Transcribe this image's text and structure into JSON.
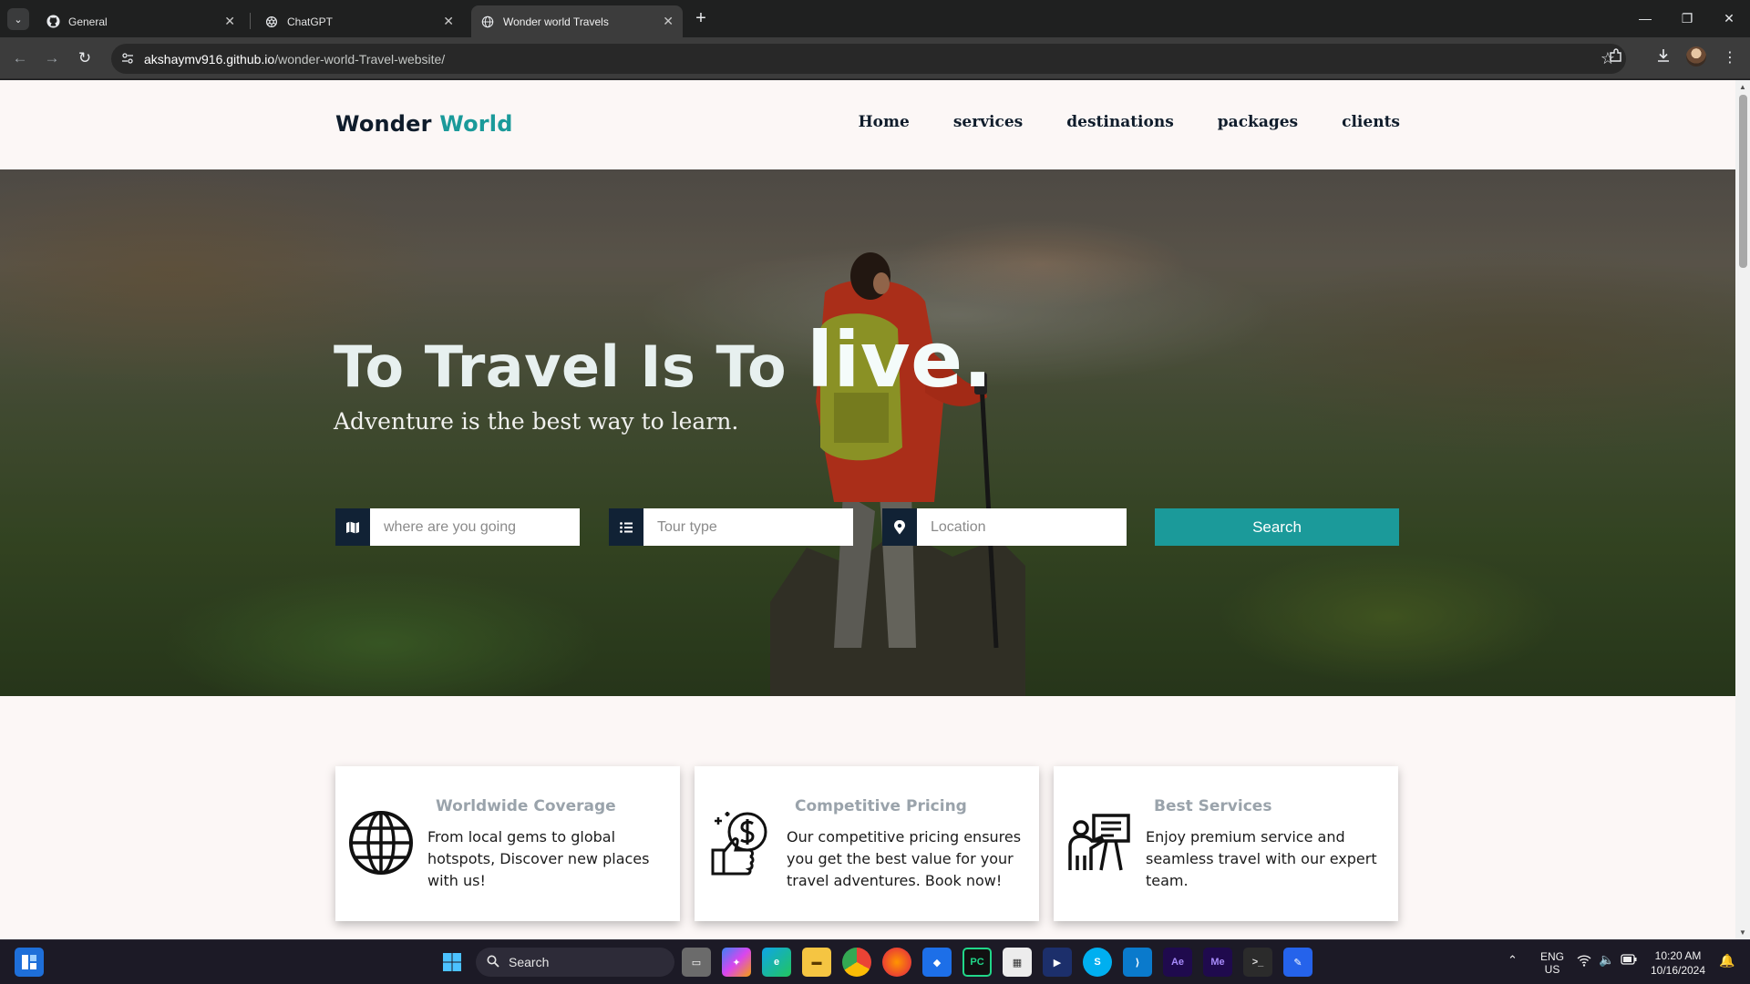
{
  "browser": {
    "tabs": [
      {
        "title": "General",
        "icon": "github-icon"
      },
      {
        "title": "ChatGPT",
        "icon": "chatgpt-icon"
      },
      {
        "title": "Wonder world Travels",
        "icon": "globe-icon",
        "active": true
      }
    ],
    "url_host": "akshaymv916.github.io",
    "url_path": "/wonder-world-Travel-website/"
  },
  "site": {
    "logo_main": "Wonder",
    "logo_accent": "World",
    "nav": [
      "Home",
      "services",
      "destinations",
      "packages",
      "clients"
    ],
    "hero": {
      "title_prefix": "To Travel Is To",
      "title_emphasis": "live.",
      "subtitle": "Adventure is the best way to learn."
    },
    "search": {
      "destination_placeholder": "where are you going",
      "tour_type_placeholder": "Tour type",
      "location_placeholder": "Location",
      "button_label": "Search"
    },
    "features": [
      {
        "title": "Worldwide Coverage",
        "text": "From local gems to global hotspots, Discover new places with us!",
        "icon": "globe-icon"
      },
      {
        "title": "Competitive Pricing",
        "text": "Our competitive pricing ensures you get the best value for your travel adventures. Book now!",
        "icon": "pricing-icon"
      },
      {
        "title": "Best Services",
        "text": "Enjoy premium service and seamless travel with our expert team.",
        "icon": "guide-icon"
      }
    ],
    "colors": {
      "accent": "#1b9a9a",
      "dark": "#112235",
      "background": "#fcf7f6"
    }
  },
  "taskbar": {
    "search_label": "Search",
    "language": "ENG",
    "region": "US",
    "time": "10:20 AM",
    "date": "10/16/2024"
  }
}
